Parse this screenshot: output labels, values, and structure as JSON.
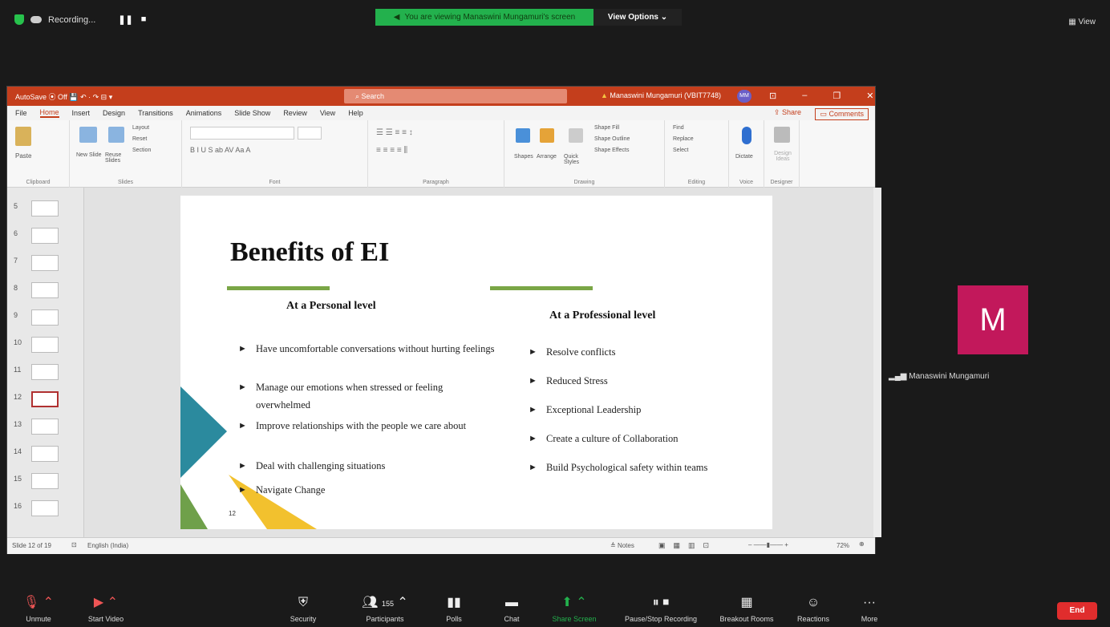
{
  "topbar": {
    "recording_label": "Recording...",
    "pause_glyph": "❚❚",
    "stop_glyph": "■",
    "banner_text": "You are viewing Manaswini Mungamuri's screen",
    "view_options_label": "View Options ⌄",
    "view_label": "View"
  },
  "ppt": {
    "quick_access": "AutoSave ⦿ Off  💾  ↶ ·  ↷  ⊟  ▾",
    "search_placeholder": "Search",
    "user_name": "Manaswini Mungamuri (VBIT7748)",
    "avatar_initials": "MM",
    "menu": [
      "File",
      "Home",
      "Insert",
      "Design",
      "Transitions",
      "Animations",
      "Slide Show",
      "Review",
      "View",
      "Help"
    ],
    "share_label": "Share",
    "comments_label": "Comments",
    "ribbon_groups": [
      "Clipboard",
      "Slides",
      "Font",
      "Paragraph",
      "Drawing",
      "Editing",
      "Voice",
      "Designer"
    ],
    "ribbon_buttons": {
      "paste": "Paste",
      "new_slide": "New Slide",
      "reuse_slides": "Reuse Slides",
      "layout": "Layout",
      "reset": "Reset",
      "section": "Section",
      "shapes": "Shapes",
      "arrange": "Arrange",
      "quick_styles": "Quick Styles",
      "shape_fill": "Shape Fill",
      "shape_outline": "Shape Outline",
      "shape_effects": "Shape Effects",
      "find": "Find",
      "replace": "Replace",
      "select": "Select",
      "dictate": "Dictate",
      "design_ideas": "Design Ideas"
    },
    "slide_numbers": [
      "5",
      "6",
      "7",
      "8",
      "9",
      "10",
      "11",
      "12",
      "13",
      "14",
      "15",
      "16"
    ],
    "status_slide": "Slide 12 of 19",
    "status_language": "English (India)",
    "status_notes": "Notes",
    "zoom": "72%"
  },
  "slide": {
    "title": "Benefits of EI",
    "left_heading": "At a Personal level",
    "right_heading": "At a Professional level",
    "left_bullets": [
      "Have uncomfortable conversations without hurting feelings",
      "Manage our emotions when stressed or feeling overwhelmed",
      "Improve relationships with the people we care about",
      "Deal with challenging situations",
      "Navigate Change"
    ],
    "right_bullets": [
      "Resolve conflicts",
      "Reduced Stress",
      "Exceptional Leadership",
      "Create a culture of Collaboration",
      "Build Psychological safety within teams"
    ],
    "page_number": "12",
    "colors": {
      "green_line": "#7aa646",
      "teal": "#2b8a9e",
      "yellow": "#f2c12e",
      "green_tri": "#6fa04a"
    }
  },
  "participant": {
    "initial": "M",
    "name": "Manaswini Mungamuri",
    "color": "#c2185b"
  },
  "toolbar": {
    "unmute": "Unmute",
    "start_video": "Start Video",
    "security": "Security",
    "participants": "Participants",
    "participant_count": "155",
    "polls": "Polls",
    "chat": "Chat",
    "share_screen": "Share Screen",
    "pause_stop_recording": "Pause/Stop Recording",
    "breakout_rooms": "Breakout Rooms",
    "reactions": "Reactions",
    "more": "More",
    "end": "End"
  }
}
